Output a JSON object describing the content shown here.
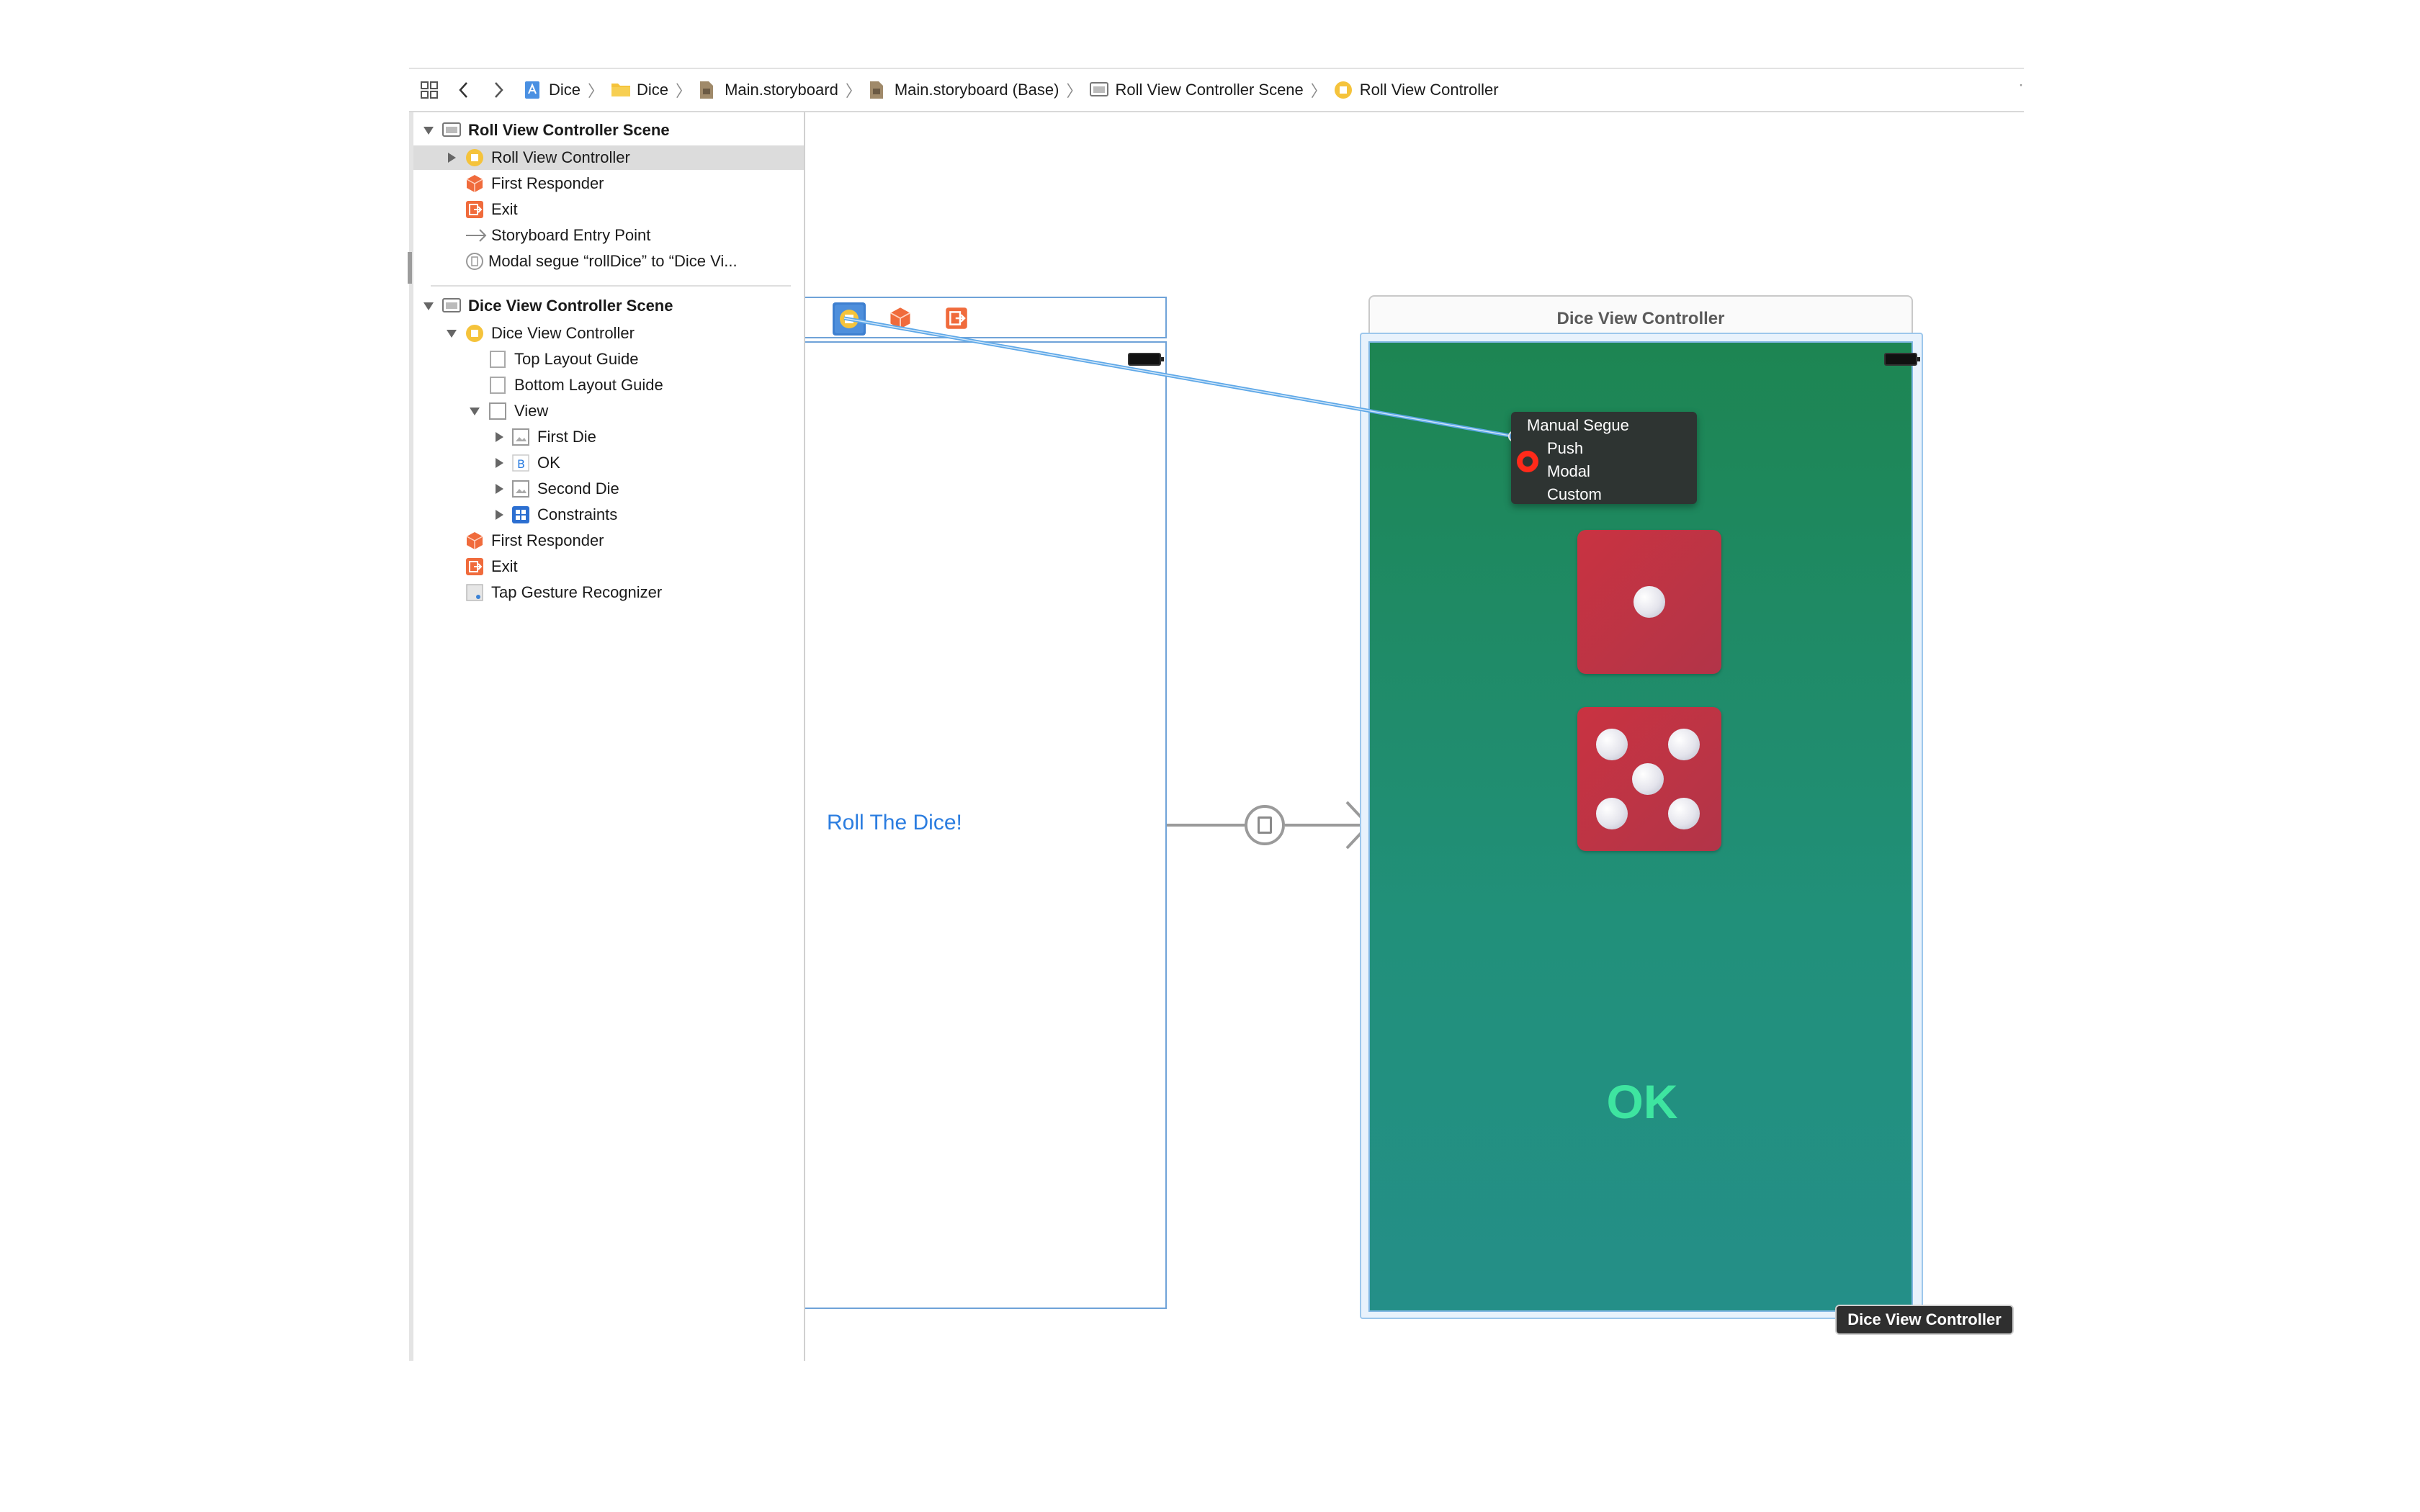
{
  "breadcrumb": {
    "items": [
      {
        "label": "Dice",
        "icon": "project-icon"
      },
      {
        "label": "Dice",
        "icon": "folder-icon"
      },
      {
        "label": "Main.storyboard",
        "icon": "storyboard-file-icon"
      },
      {
        "label": "Main.storyboard (Base)",
        "icon": "storyboard-file-icon"
      },
      {
        "label": "Roll View Controller Scene",
        "icon": "scene-icon"
      },
      {
        "label": "Roll View Controller",
        "icon": "view-controller-icon"
      }
    ]
  },
  "outline": {
    "rows": [
      {
        "label": "Roll View Controller Scene",
        "icon": "scene-icon",
        "expanded": true,
        "bold": true
      },
      {
        "label": "Roll View Controller",
        "icon": "view-controller-icon",
        "expanded": false,
        "selected": true
      },
      {
        "label": "First Responder",
        "icon": "first-responder-icon"
      },
      {
        "label": "Exit",
        "icon": "exit-icon"
      },
      {
        "label": "Storyboard Entry Point",
        "icon": "arrow-right-icon"
      },
      {
        "label": "Modal segue “rollDice” to “Dice Vi...",
        "icon": "segue-icon"
      },
      {
        "label": "Dice View Controller Scene",
        "icon": "scene-icon",
        "expanded": true,
        "bold": true
      },
      {
        "label": "Dice View Controller",
        "icon": "view-controller-icon",
        "expanded": true
      },
      {
        "label": "Top Layout Guide",
        "icon": "layout-guide-icon"
      },
      {
        "label": "Bottom Layout Guide",
        "icon": "layout-guide-icon"
      },
      {
        "label": "View",
        "icon": "view-icon",
        "expanded": true
      },
      {
        "label": "First Die",
        "icon": "image-view-icon",
        "expanded": false
      },
      {
        "label": "OK",
        "icon": "button-icon",
        "expanded": false
      },
      {
        "label": "Second Die",
        "icon": "image-view-icon",
        "expanded": false
      },
      {
        "label": "Constraints",
        "icon": "constraints-icon",
        "expanded": false
      },
      {
        "label": "First Responder",
        "icon": "first-responder-icon"
      },
      {
        "label": "Exit",
        "icon": "exit-icon"
      },
      {
        "label": "Tap Gesture Recognizer",
        "icon": "gesture-recognizer-icon"
      }
    ]
  },
  "roll_scene": {
    "button_label": "Roll The Dice!"
  },
  "dice_scene": {
    "title": "Dice View Controller",
    "ok_label": "OK",
    "first_die_value": 1,
    "second_die_value": 5
  },
  "segue_menu": {
    "header": "Manual Segue",
    "options": [
      "Push",
      "Modal",
      "Custom"
    ],
    "highlighted": "Modal"
  },
  "tooltip": "Dice View Controller",
  "colors": {
    "scene_bg_top": "#1d8552",
    "scene_bg_bottom": "#248f88",
    "die": "#c03442",
    "ok_text": "#3ee5a0",
    "link_blue": "#2b7de0",
    "selection_blue": "#9dc7ec"
  }
}
